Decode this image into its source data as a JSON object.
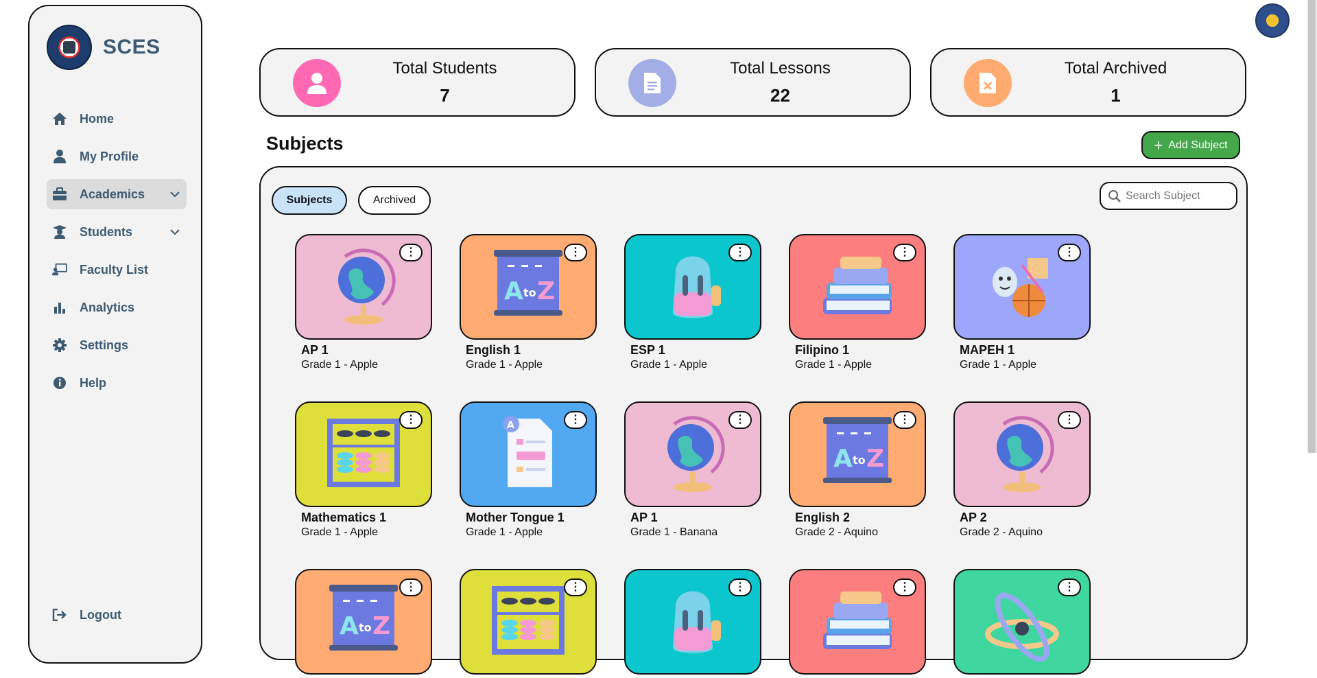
{
  "brand": {
    "name": "SCES"
  },
  "sidebar": {
    "items": [
      {
        "label": "Home",
        "icon": "home-icon"
      },
      {
        "label": "My Profile",
        "icon": "user-icon"
      },
      {
        "label": "Academics",
        "icon": "briefcase-icon",
        "active": true,
        "expandable": true
      },
      {
        "label": "Students",
        "icon": "graduate-icon",
        "expandable": true
      },
      {
        "label": "Faculty List",
        "icon": "teacher-board-icon"
      },
      {
        "label": "Analytics",
        "icon": "bar-chart-icon"
      },
      {
        "label": "Settings",
        "icon": "gear-icon"
      },
      {
        "label": "Help",
        "icon": "info-icon"
      }
    ],
    "logout": "Logout"
  },
  "stats": [
    {
      "label": "Total Students",
      "value": "7",
      "color": "#ff69b4"
    },
    {
      "label": "Total Lessons",
      "value": "22",
      "color": "#a3aee6"
    },
    {
      "label": "Total Archived",
      "value": "1",
      "color": "#ffab70"
    }
  ],
  "subjects_header": {
    "title": "Subjects",
    "add_label": "Add Subject"
  },
  "tabs": {
    "subjects": "Subjects",
    "archived": "Archived"
  },
  "search": {
    "placeholder": "Search Subject"
  },
  "cards": [
    {
      "name": "AP 1",
      "sub": "Grade 1 - Apple",
      "color": "#eebbd3",
      "art": "globe"
    },
    {
      "name": "English 1",
      "sub": "Grade 1 - Apple",
      "color": "#ffab72",
      "art": "board"
    },
    {
      "name": "ESP 1",
      "sub": "Grade 1 - Apple",
      "color": "#0bc6cc",
      "art": "backpack"
    },
    {
      "name": "Filipino 1",
      "sub": "Grade 1 - Apple",
      "color": "#fd7e7e",
      "art": "books"
    },
    {
      "name": "MAPEH 1",
      "sub": "Grade 1 - Apple",
      "color": "#9da7fb",
      "art": "mapeh"
    },
    {
      "name": "Mathematics 1",
      "sub": "Grade 1 - Apple",
      "color": "#dfdf3b",
      "art": "abacus"
    },
    {
      "name": "Mother Tongue 1",
      "sub": "Grade 1 - Apple",
      "color": "#52a9f2",
      "art": "paper"
    },
    {
      "name": "AP 1",
      "sub": "Grade 1 - Banana",
      "color": "#eebbd3",
      "art": "globe"
    },
    {
      "name": "English 2",
      "sub": "Grade 2 - Aquino",
      "color": "#ffab72",
      "art": "board"
    },
    {
      "name": "AP 2",
      "sub": "Grade 2 - Aquino",
      "color": "#eebbd3",
      "art": "globe"
    },
    {
      "name": "",
      "sub": "",
      "color": "#ffab72",
      "art": "board"
    },
    {
      "name": "",
      "sub": "",
      "color": "#dfdf3b",
      "art": "abacus"
    },
    {
      "name": "",
      "sub": "",
      "color": "#0bc6cc",
      "art": "backpack"
    },
    {
      "name": "",
      "sub": "",
      "color": "#fd7e7e",
      "art": "books"
    },
    {
      "name": "",
      "sub": "",
      "color": "#3fd6a0",
      "art": "atom"
    }
  ]
}
